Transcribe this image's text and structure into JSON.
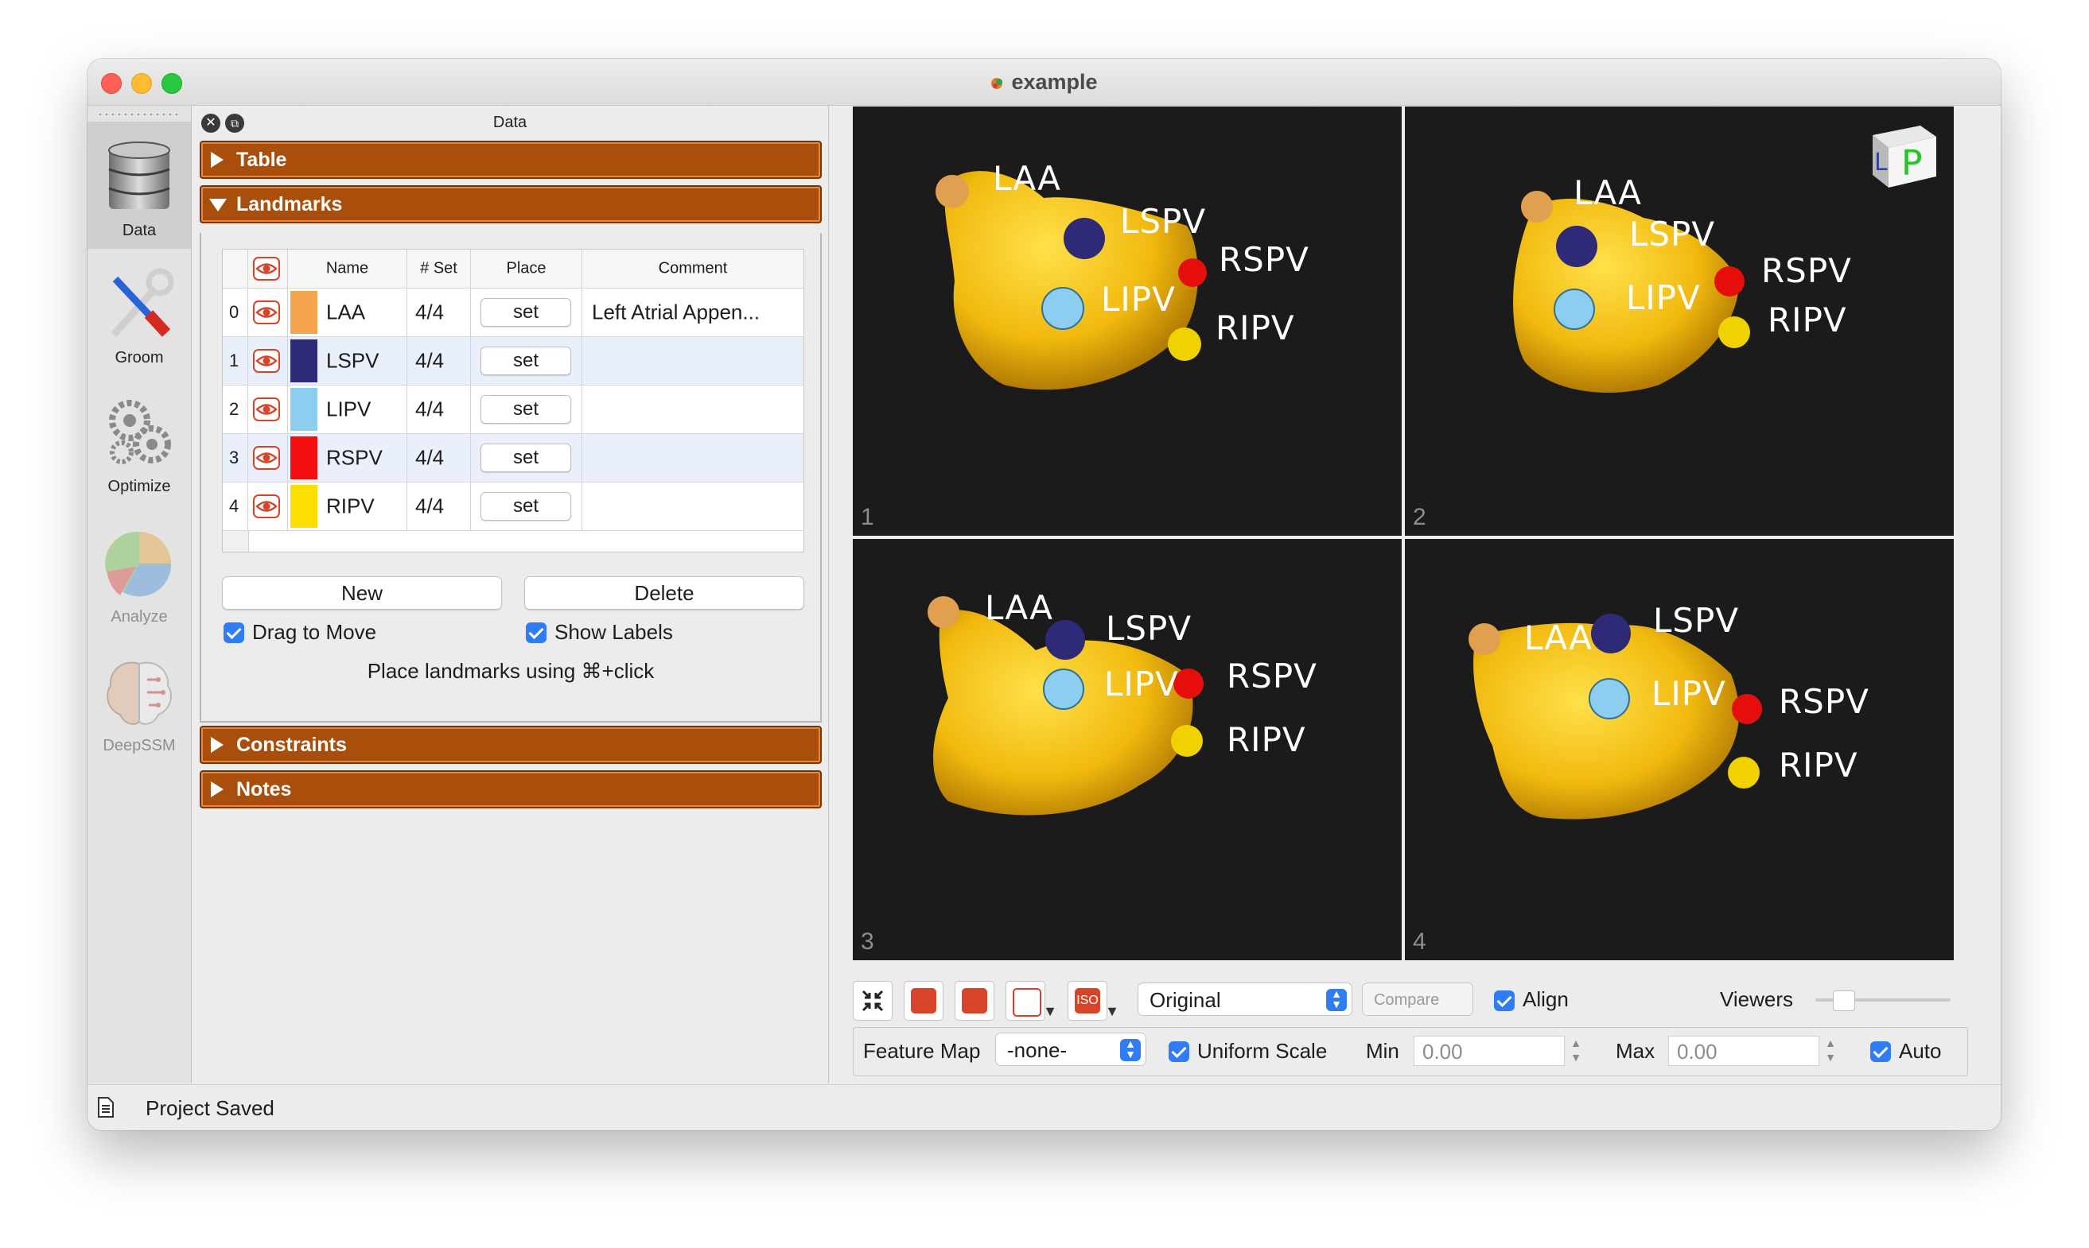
{
  "window": {
    "title": "example"
  },
  "modules": [
    {
      "label": "Data",
      "icon": "database-icon",
      "active": true
    },
    {
      "label": "Groom",
      "icon": "tools-icon",
      "active": false
    },
    {
      "label": "Optimize",
      "icon": "gears-icon",
      "active": false
    },
    {
      "label": "Analyze",
      "icon": "pie-chart-icon",
      "disabled": true
    },
    {
      "label": "DeepSSM",
      "icon": "brain-icon",
      "disabled": true
    }
  ],
  "dock": {
    "title": "Data",
    "sections": {
      "table": "Table",
      "landmarks": "Landmarks",
      "constraints": "Constraints",
      "notes": "Notes"
    }
  },
  "landmarks": {
    "headers": {
      "name": "Name",
      "set": "# Set",
      "place": "Place",
      "comment": "Comment"
    },
    "rows": [
      {
        "index": "0",
        "color": "#f4a54c",
        "name": "LAA",
        "set": "4/4",
        "place": "set",
        "comment": "Left Atrial Appen..."
      },
      {
        "index": "1",
        "color": "#2e2a78",
        "name": "LSPV",
        "set": "4/4",
        "place": "set",
        "comment": ""
      },
      {
        "index": "2",
        "color": "#8ccdf0",
        "name": "LIPV",
        "set": "4/4",
        "place": "set",
        "comment": ""
      },
      {
        "index": "3",
        "color": "#f40f0f",
        "name": "RSPV",
        "set": "4/4",
        "place": "set",
        "comment": ""
      },
      {
        "index": "4",
        "color": "#fbdf00",
        "name": "RIPV",
        "set": "4/4",
        "place": "set",
        "comment": ""
      }
    ],
    "new_button": "New",
    "delete_button": "Delete",
    "drag_to_move": "Drag to Move",
    "show_labels": "Show Labels",
    "hint": "Place landmarks using ⌘+click"
  },
  "viewers": [
    {
      "index": "1",
      "labels": [
        "LAA",
        "LSPV",
        "RSPV",
        "LIPV",
        "RIPV"
      ]
    },
    {
      "index": "2",
      "labels": [
        "LAA",
        "LSPV",
        "RSPV",
        "LIPV",
        "RIPV"
      ]
    },
    {
      "index": "3",
      "labels": [
        "LAA",
        "LSPV",
        "RSPV",
        "LIPV",
        "RIPV"
      ]
    },
    {
      "index": "4",
      "labels": [
        "LAA",
        "LSPV",
        "RSPV",
        "LIPV",
        "RIPV"
      ]
    }
  ],
  "orientation_marker": "LP",
  "toolbar": {
    "display_mode": "Original",
    "compare": "Compare",
    "align": "Align",
    "viewers": "Viewers",
    "iso": "ISO"
  },
  "feature": {
    "feature_map_label": "Feature Map",
    "feature_map_value": "-none-",
    "uniform_scale": "Uniform Scale",
    "min_label": "Min",
    "min_value": "0.00",
    "max_label": "Max",
    "max_value": "0.00",
    "auto": "Auto"
  },
  "status": {
    "text": "Project Saved"
  },
  "colors": {
    "section": "#a94f0b",
    "mesh": "#f7c21a",
    "accent": "#2f7cf6"
  }
}
